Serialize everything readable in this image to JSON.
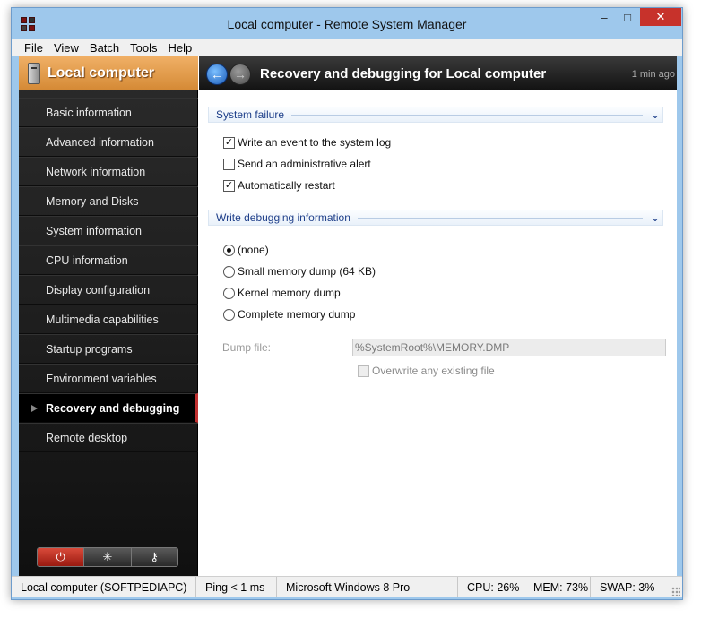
{
  "window": {
    "title": "Local computer - Remote System Manager",
    "controls": {
      "minimize": "–",
      "maximize": "□",
      "close": "✕"
    }
  },
  "menu": [
    "File",
    "View",
    "Batch",
    "Tools",
    "Help"
  ],
  "sidebar": {
    "title": "Local computer",
    "items": [
      "Basic information",
      "Advanced information",
      "Network information",
      "Memory and Disks",
      "System information",
      "CPU information",
      "Display configuration",
      "Multimedia capabilities",
      "Startup programs",
      "Environment variables",
      "Recovery and debugging",
      "Remote desktop"
    ],
    "active_index": 10,
    "buttons": {
      "power": "⏻",
      "refresh": "✳",
      "key": "⚷"
    }
  },
  "main": {
    "title": "Recovery and debugging for Local computer",
    "time": "1 min ago",
    "system_failure": {
      "label": "System failure",
      "options": [
        {
          "label": "Write an event to the system log",
          "checked": true
        },
        {
          "label": "Send an administrative alert",
          "checked": false
        },
        {
          "label": "Automatically restart",
          "checked": true
        }
      ]
    },
    "debugging": {
      "label": "Write debugging information",
      "options": [
        {
          "label": "(none)",
          "selected": true
        },
        {
          "label": "Small memory dump (64 KB)",
          "selected": false
        },
        {
          "label": "Kernel memory dump",
          "selected": false
        },
        {
          "label": "Complete memory dump",
          "selected": false
        }
      ],
      "dump_file_label": "Dump file:",
      "dump_file_value": "%SystemRoot%\\MEMORY.DMP",
      "overwrite_label": "Overwrite any existing file",
      "overwrite_checked": false
    }
  },
  "status": {
    "computer": "Local computer (SOFTPEDIAPC)",
    "ping": "Ping < 1 ms",
    "os": "Microsoft Windows 8 Pro",
    "cpu": "CPU: 26%",
    "mem": "MEM: 73%",
    "swap": "SWAP: 3%"
  },
  "colors": {
    "accent_orange": "#d58a36",
    "active_marker": "#c03030",
    "group_text": "#1e3f8a",
    "window_frame": "#9ec8ec"
  }
}
